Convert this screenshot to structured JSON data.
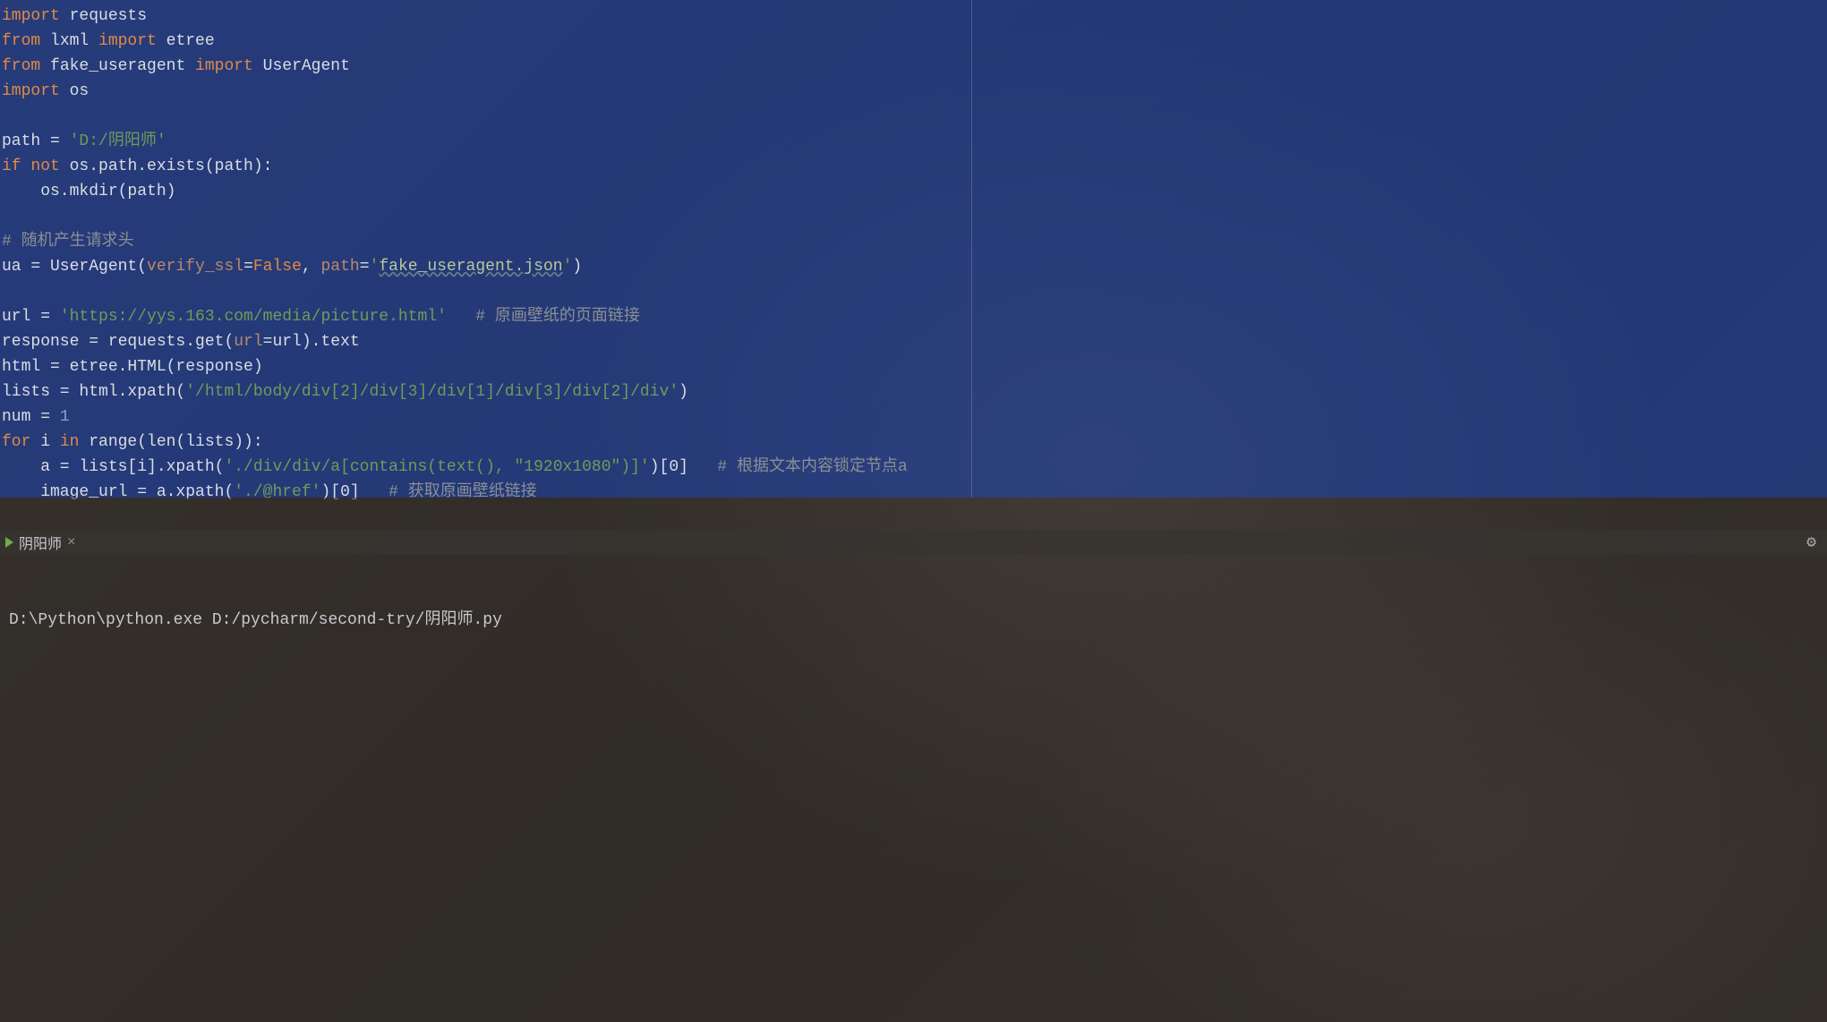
{
  "editor": {
    "lines": [
      {
        "segments": [
          {
            "c": "kw",
            "t": "import"
          },
          {
            "c": "ident",
            "t": " requests"
          }
        ]
      },
      {
        "segments": [
          {
            "c": "kw",
            "t": "from"
          },
          {
            "c": "ident",
            "t": " lxml "
          },
          {
            "c": "kw",
            "t": "import"
          },
          {
            "c": "ident",
            "t": " etree"
          }
        ]
      },
      {
        "segments": [
          {
            "c": "kw",
            "t": "from"
          },
          {
            "c": "ident",
            "t": " fake_useragent "
          },
          {
            "c": "kw",
            "t": "import"
          },
          {
            "c": "ident",
            "t": " UserAgent"
          }
        ]
      },
      {
        "segments": [
          {
            "c": "kw",
            "t": "import"
          },
          {
            "c": "ident",
            "t": " os"
          }
        ]
      },
      {
        "segments": []
      },
      {
        "segments": [
          {
            "c": "ident",
            "t": "path = "
          },
          {
            "c": "str",
            "t": "'D:/阴阳师'"
          }
        ]
      },
      {
        "segments": [
          {
            "c": "kw",
            "t": "if"
          },
          {
            "c": "ident",
            "t": " "
          },
          {
            "c": "kw",
            "t": "not"
          },
          {
            "c": "ident",
            "t": " os.path.exists(path):"
          }
        ]
      },
      {
        "segments": [
          {
            "c": "ident",
            "t": "    os.mkdir(path)"
          }
        ]
      },
      {
        "segments": []
      },
      {
        "segments": [
          {
            "c": "com",
            "t": "# 随机产生请求头"
          }
        ]
      },
      {
        "segments": [
          {
            "c": "ident",
            "t": "ua = UserAgent("
          },
          {
            "c": "param",
            "t": "verify_ssl"
          },
          {
            "c": "ident",
            "t": "="
          },
          {
            "c": "bool",
            "t": "False"
          },
          {
            "c": "ident",
            "t": ", "
          },
          {
            "c": "param",
            "t": "path"
          },
          {
            "c": "ident",
            "t": "="
          },
          {
            "c": "str",
            "t": "'"
          },
          {
            "c": "strb",
            "t": "fake_useragent.json"
          },
          {
            "c": "str",
            "t": "'"
          },
          {
            "c": "ident",
            "t": ")"
          }
        ]
      },
      {
        "segments": []
      },
      {
        "segments": [
          {
            "c": "ident",
            "t": "url = "
          },
          {
            "c": "str",
            "t": "'https://yys.163.com/media/picture.html'"
          },
          {
            "c": "ident",
            "t": "   "
          },
          {
            "c": "com",
            "t": "# 原画壁纸的页面链接"
          }
        ]
      },
      {
        "segments": [
          {
            "c": "ident",
            "t": "response = requests.get("
          },
          {
            "c": "param",
            "t": "url"
          },
          {
            "c": "ident",
            "t": "=url).text"
          }
        ]
      },
      {
        "segments": [
          {
            "c": "ident",
            "t": "html = etree.HTML(response)"
          }
        ]
      },
      {
        "segments": [
          {
            "c": "ident",
            "t": "lists = html.xpath("
          },
          {
            "c": "str",
            "t": "'/html/body/div[2]/div[3]/div[1]/div[3]/div[2]/div'"
          },
          {
            "c": "ident",
            "t": ")"
          }
        ]
      },
      {
        "segments": [
          {
            "c": "ident",
            "t": "num = "
          },
          {
            "c": "num",
            "t": "1"
          }
        ]
      },
      {
        "segments": [
          {
            "c": "kw",
            "t": "for"
          },
          {
            "c": "ident",
            "t": " i "
          },
          {
            "c": "kw",
            "t": "in"
          },
          {
            "c": "ident",
            "t": " range(len(lists)):"
          }
        ]
      },
      {
        "segments": [
          {
            "c": "ident",
            "t": "    a = lists[i].xpath("
          },
          {
            "c": "str",
            "t": "'./div/div/a[contains(text(), \"1920x1080\")]'"
          },
          {
            "c": "ident",
            "t": ")[0]   "
          },
          {
            "c": "com",
            "t": "# 根据文本内容锁定节点a"
          }
        ]
      },
      {
        "segments": [
          {
            "c": "ident",
            "t": "    image_url = a.xpath("
          },
          {
            "c": "str",
            "t": "'./@href'"
          },
          {
            "c": "ident",
            "t": ")[0]   "
          },
          {
            "c": "com",
            "t": "# 获取原画壁纸链接"
          }
        ]
      }
    ]
  },
  "runTab": {
    "name": "阴阳师",
    "close": "×",
    "gear": "⚙"
  },
  "console": {
    "line1": "D:\\Python\\python.exe D:/pycharm/second-try/阴阳师.py"
  }
}
